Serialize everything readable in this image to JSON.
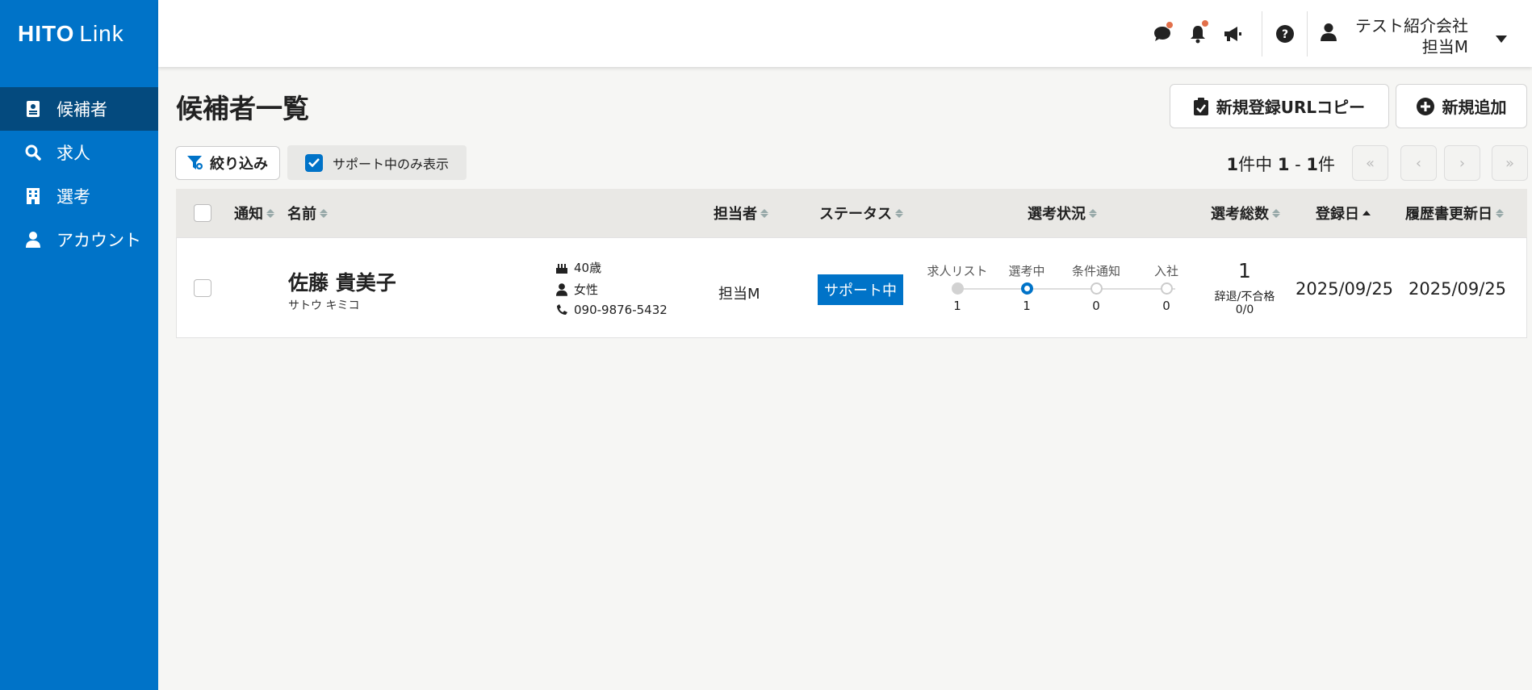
{
  "app": {
    "logo_bold": "HITO",
    "logo_light": "Link"
  },
  "sidebar": {
    "items": [
      {
        "label": "候補者",
        "icon": "id-badge-icon",
        "active": true
      },
      {
        "label": "求人",
        "icon": "search-icon",
        "active": false
      },
      {
        "label": "選考",
        "icon": "building-icon",
        "active": false
      },
      {
        "label": "アカウント",
        "icon": "user-icon",
        "active": false
      }
    ]
  },
  "header": {
    "icons": [
      "chat-icon",
      "bell-icon",
      "megaphone-icon",
      "help-icon"
    ],
    "user_org": "テスト紹介会社",
    "user_name": "担当M"
  },
  "page": {
    "title": "候補者一覧",
    "copy_url_button": "新規登録URLコピー",
    "add_button": "新規追加"
  },
  "filters": {
    "filter_button": "絞り込み",
    "support_only_label": "サポート中のみ表示",
    "support_only_checked": true
  },
  "pagination": {
    "total": "1",
    "total_suffix": "件中",
    "range_start": "1",
    "range_sep": " - ",
    "range_end": "1",
    "range_suffix": "件"
  },
  "table": {
    "columns": {
      "notify": "通知",
      "name": "名前",
      "owner": "担当者",
      "status": "ステータス",
      "selection": "選考状況",
      "total": "選考総数",
      "registered": "登録日",
      "resume_updated": "履歴書更新日"
    },
    "rows": [
      {
        "name": "佐藤 貴美子",
        "kana": "サトウ キミコ",
        "age": "40歳",
        "gender": "女性",
        "phone": "090-9876-5432",
        "owner": "担当M",
        "status": "サポート中",
        "stages": [
          {
            "label": "求人リスト",
            "count": "1",
            "state": "done"
          },
          {
            "label": "選考中",
            "count": "1",
            "state": "active"
          },
          {
            "label": "条件通知",
            "count": "0",
            "state": "open"
          },
          {
            "label": "入社",
            "count": "0",
            "state": "open"
          }
        ],
        "total": "1",
        "reject_label": "辞退/不合格",
        "reject_value": "0/0",
        "registered": "2025/09/25",
        "resume_updated": "2025/09/25"
      }
    ]
  },
  "colors": {
    "brand": "#0073c8",
    "sidebar_active": "#044a7e",
    "badge_dot": "#e2704b"
  }
}
